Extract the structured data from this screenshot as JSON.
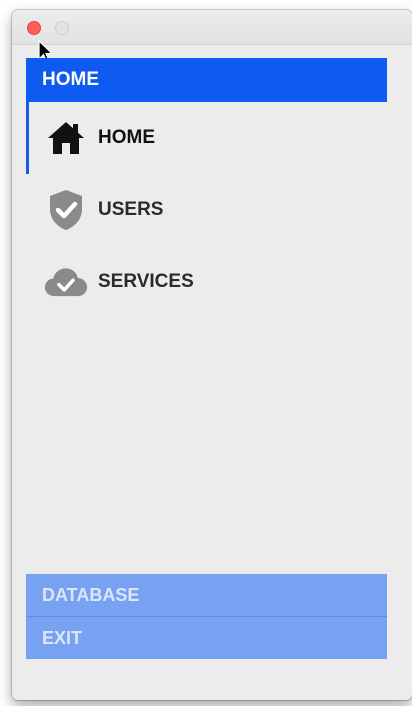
{
  "header": {
    "title": "HOME"
  },
  "menu": {
    "items": [
      {
        "label": "HOME",
        "icon": "home-icon",
        "active": true
      },
      {
        "label": "USERS",
        "icon": "shield-check-icon",
        "active": false
      },
      {
        "label": "SERVICES",
        "icon": "cloud-check-icon",
        "active": false
      }
    ]
  },
  "bottom_menu": {
    "items": [
      {
        "label": "DATABASE"
      },
      {
        "label": "EXIT"
      }
    ]
  },
  "colors": {
    "header": "#0f5af0",
    "bottom": "#77a2f2",
    "window": "#ececec",
    "close_button": "#fe5f57",
    "icon_gray": "#8a8a8a"
  }
}
